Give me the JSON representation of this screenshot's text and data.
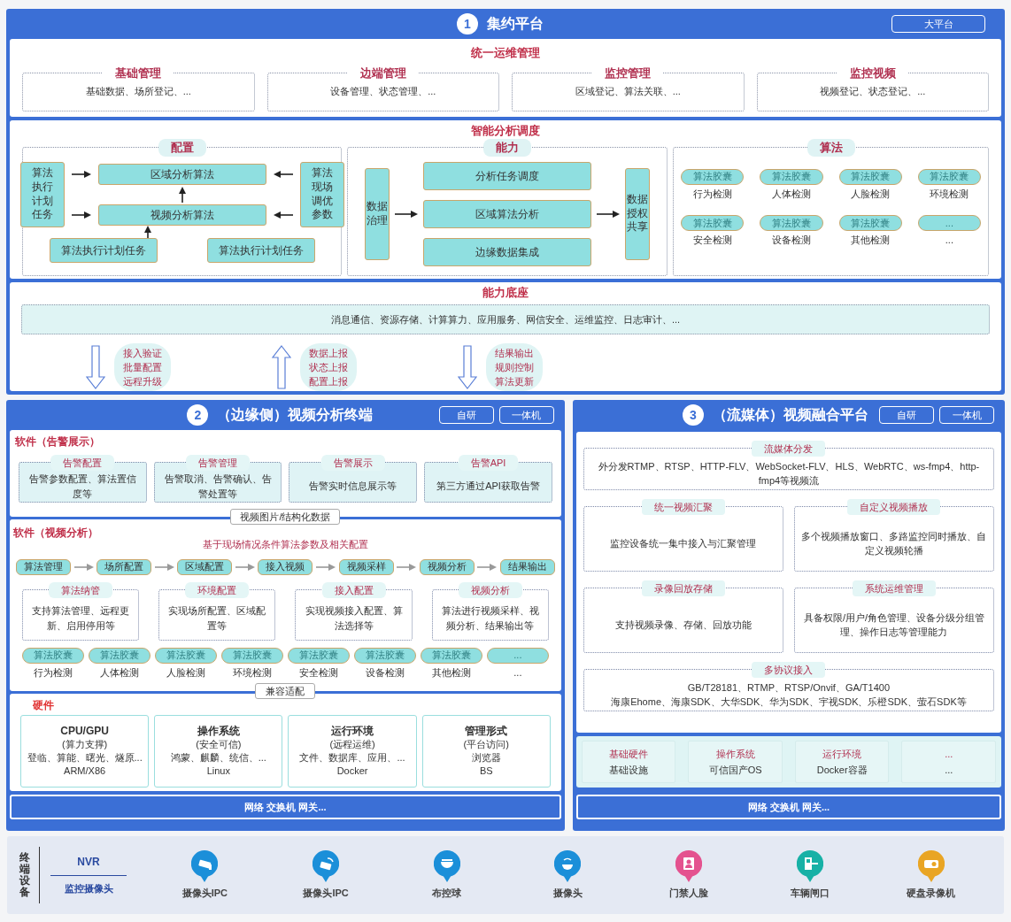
{
  "platform": {
    "number": "1",
    "title": "集约平台",
    "badge": "大平台",
    "ops": {
      "title": "统一运维管理",
      "groups": [
        {
          "title": "基础管理",
          "text": "基础数据、场所登记、..."
        },
        {
          "title": "边端管理",
          "text": "设备管理、状态管理、..."
        },
        {
          "title": "监控管理",
          "text": "区域登记、算法关联、..."
        },
        {
          "title": "监控视频",
          "text": "视频登记、状态登记、..."
        }
      ]
    },
    "scheduling": {
      "title": "智能分析调度",
      "config": {
        "title": "配置",
        "left": "算法执行计划任务",
        "right": "算法现场调优参数",
        "top": "区域分析算法",
        "middle": "视频分析算法",
        "bottom": [
          "算法执行计划任务",
          "算法执行计划任务"
        ]
      },
      "ability": {
        "title": "能力",
        "input": "数据治理",
        "tasks": [
          "分析任务调度",
          "区域算法分析",
          "边缘数据集成"
        ],
        "output": "数据授权共享"
      },
      "algorithms": {
        "title": "算法",
        "items": [
          {
            "tag": "算法胶囊",
            "label": "行为检测"
          },
          {
            "tag": "算法胶囊",
            "label": "人体检测"
          },
          {
            "tag": "算法胶囊",
            "label": "人脸检测"
          },
          {
            "tag": "算法胶囊",
            "label": "环境检测"
          },
          {
            "tag": "算法胶囊",
            "label": "安全检测"
          },
          {
            "tag": "算法胶囊",
            "label": "设备检测"
          },
          {
            "tag": "算法胶囊",
            "label": "其他检测"
          },
          {
            "tag": "...",
            "label": "..."
          }
        ]
      }
    },
    "base": {
      "title": "能力底座",
      "text": "消息通信、资源存储、计算算力、应用服务、网信安全、运维监控、日志审计、...",
      "flows": [
        {
          "kind": "down",
          "lines": [
            "接入验证",
            "批量配置",
            "远程升级"
          ]
        },
        {
          "kind": "up",
          "lines": [
            "数据上报",
            "状态上报",
            "配置上报"
          ]
        },
        {
          "kind": "down",
          "lines": [
            "结果输出",
            "规则控制",
            "算法更新"
          ]
        }
      ]
    }
  },
  "edge": {
    "number": "2",
    "title": "（边缘侧）视频分析终端",
    "badges": [
      "自研",
      "一体机"
    ],
    "alarm": {
      "title": "软件（告警展示）",
      "cards": [
        {
          "title": "告警配置",
          "text": "告警参数配置、算法置信度等"
        },
        {
          "title": "告警管理",
          "text": "告警取消、告警确认、告警处置等"
        },
        {
          "title": "告警展示",
          "text": "告警实时信息展示等"
        },
        {
          "title": "告警API",
          "text": "第三方通过API获取告警"
        }
      ]
    },
    "link_1": "视频图片/结构化数据",
    "analysis": {
      "title": "软件（视频分析）",
      "subtitle": "基于现场情况条件算法参数及相关配置",
      "steps": [
        "算法管理",
        "场所配置",
        "区域配置",
        "接入视频",
        "视频采样",
        "视频分析",
        "结果输出"
      ],
      "cards": [
        {
          "title": "算法纳管",
          "text": "支持算法管理、远程更新、启用停用等"
        },
        {
          "title": "环境配置",
          "text": "实现场所配置、区域配置等"
        },
        {
          "title": "接入配置",
          "text": "实现视频接入配置、算法选择等"
        },
        {
          "title": "视频分析",
          "text": "算法进行视频采样、视频分析、结果输出等"
        }
      ],
      "capsules": [
        {
          "tag": "算法胶囊",
          "label": "行为检测"
        },
        {
          "tag": "算法胶囊",
          "label": "人体检测"
        },
        {
          "tag": "算法胶囊",
          "label": "人脸检测"
        },
        {
          "tag": "算法胶囊",
          "label": "环境检测"
        },
        {
          "tag": "算法胶囊",
          "label": "安全检测"
        },
        {
          "tag": "算法胶囊",
          "label": "设备检测"
        },
        {
          "tag": "算法胶囊",
          "label": "其他检测"
        },
        {
          "tag": "...",
          "label": "..."
        }
      ]
    },
    "link_2": "兼容适配",
    "hardware": {
      "title": "硬件",
      "cards": [
        {
          "title": "CPU/GPU",
          "subtitle": "(算力支撑)",
          "lines": [
            "登临、算能、曙光、燧原...",
            "ARM/X86"
          ]
        },
        {
          "title": "操作系统",
          "subtitle": "(安全可信)",
          "lines": [
            "鸿蒙、麒麟、统信、...",
            "Linux"
          ]
        },
        {
          "title": "运行环境",
          "subtitle": "(远程运维)",
          "lines": [
            "文件、数据库、应用、...",
            "Docker"
          ]
        },
        {
          "title": "管理形式",
          "subtitle": "(平台访问)",
          "lines": [
            "浏览器",
            "BS"
          ]
        }
      ]
    },
    "network": "网络 交换机 网关..."
  },
  "media": {
    "number": "3",
    "title": "（流媒体）视频融合平台",
    "badges": [
      "自研",
      "一体机"
    ],
    "features": [
      {
        "title": "流媒体分发",
        "wide": true,
        "lines": [
          "外分发RTMP、RTSP、HTTP-FLV、WebSocket-FLV、HLS、WebRTC、ws-fmp4、http-fmp4等视频流"
        ]
      },
      {
        "title": "统一视频汇聚",
        "wide": false,
        "lines": [
          "监控设备统一集中接入与汇聚管理"
        ]
      },
      {
        "title": "自定义视频播放",
        "wide": false,
        "lines": [
          "多个视频播放窗口、多路监控同时播放、自定义视频轮播"
        ]
      },
      {
        "title": "录像回放存储",
        "wide": false,
        "lines": [
          "支持视频录像、存储、回放功能"
        ]
      },
      {
        "title": "系统运维管理",
        "wide": false,
        "lines": [
          "具备权限/用户/角色管理、设备分级分组管理、操作日志等管理能力"
        ]
      },
      {
        "title": "多协议接入",
        "wide": true,
        "lines": [
          "GB/T28181、RTMP、RTSP/Onvif、GA/T1400",
          "海康Ehome、海康SDK、大华SDK、华为SDK、宇视SDK、乐橙SDK、萤石SDK等"
        ]
      }
    ],
    "infra": [
      {
        "title": "基础硬件",
        "text": "基础设施"
      },
      {
        "title": "操作系统",
        "text": "可信国产OS"
      },
      {
        "title": "运行环境",
        "text": "Docker容器"
      },
      {
        "title": "...",
        "text": "..."
      }
    ],
    "network": "网络 交换机 网关..."
  },
  "devices": {
    "label": "终端设备",
    "nvr": "NVR",
    "nvr_sub": "监控摄像头",
    "items": [
      {
        "kind": "camera",
        "label": "摄像头IPC",
        "color": "#1b8fd9"
      },
      {
        "kind": "wifi-camera",
        "label": "摄像头IPC",
        "color": "#1b8fd9"
      },
      {
        "kind": "dome",
        "label": "布控球",
        "color": "#1b8fd9"
      },
      {
        "kind": "wifi-dome",
        "label": "摄像头",
        "color": "#1b8fd9"
      },
      {
        "kind": "face",
        "label": "门禁人脸",
        "color": "#e4528f"
      },
      {
        "kind": "gate",
        "label": "车辆闸口",
        "color": "#17b1a6"
      },
      {
        "kind": "recorder",
        "label": "硬盘录像机",
        "color": "#e9a524"
      }
    ]
  }
}
